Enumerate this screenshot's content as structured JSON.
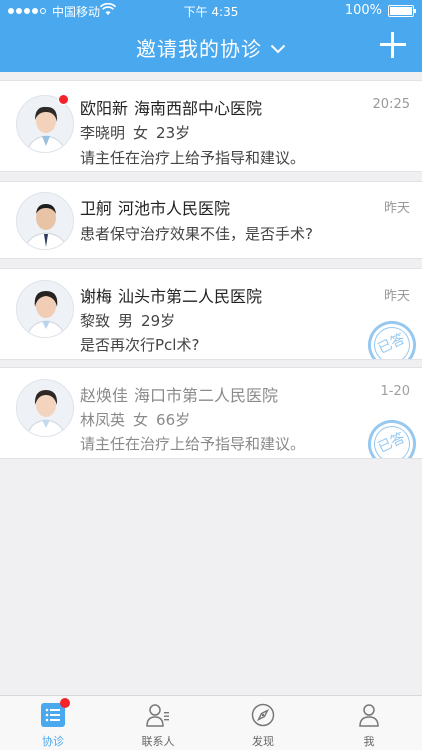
{
  "status_bar": {
    "carrier": "中国移动",
    "time": "下午 4:35",
    "battery_percent": "100%",
    "signal_bars_filled": 4,
    "signal_bars_total": 5
  },
  "header": {
    "title": "邀请我的协诊",
    "dropdown_icon": "chevron-down-icon",
    "add_icon": "plus-icon",
    "background_color": "#4aa8ef"
  },
  "consultations": [
    {
      "doctor": "欧阳新",
      "hospital": "海南西部中心医院",
      "time": "20:25",
      "patient_name": "李晓明",
      "patient_sex": "女",
      "patient_age": "23岁",
      "message": "请主任在治疗上给予指导和建议。",
      "unread": true,
      "answered": false,
      "muted": false
    },
    {
      "doctor": "卫舸",
      "hospital": "河池市人民医院",
      "time": "昨天",
      "message": "患者保守治疗效果不佳，是否手术?",
      "unread": false,
      "answered": false,
      "muted": false
    },
    {
      "doctor": "谢梅",
      "hospital": "汕头市第二人民医院",
      "time": "昨天",
      "patient_name": "黎致",
      "patient_sex": "男",
      "patient_age": "29岁",
      "message": "是否再次行Pcl术?",
      "unread": false,
      "answered": true,
      "stamp_text": "已答",
      "muted": false
    },
    {
      "doctor": "赵焕佳",
      "hospital": "海口市第二人民医院",
      "time": "1-20",
      "patient_name": "林凤英",
      "patient_sex": "女",
      "patient_age": "66岁",
      "message": "请主任在治疗上给予指导和建议。",
      "unread": false,
      "answered": true,
      "stamp_text": "已答",
      "muted": true
    }
  ],
  "tabbar": {
    "tabs": [
      {
        "label": "协诊",
        "icon": "list-icon",
        "active": true,
        "badge": true
      },
      {
        "label": "联系人",
        "icon": "contacts-icon",
        "active": false,
        "badge": false
      },
      {
        "label": "发现",
        "icon": "compass-icon",
        "active": false,
        "badge": false
      },
      {
        "label": "我",
        "icon": "user-icon",
        "active": false,
        "badge": false
      }
    ],
    "active_color": "#4aa8ef"
  }
}
